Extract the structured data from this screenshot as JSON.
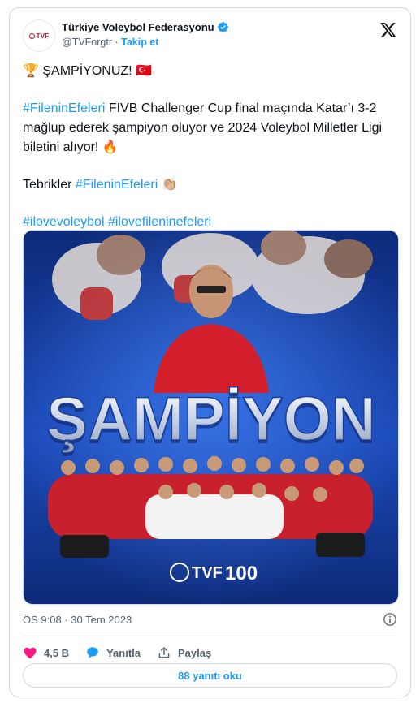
{
  "author": {
    "avatar_text": "TVF",
    "display_name": "Türkiye Voleybol Federasyonu",
    "handle": "@TVForgtr",
    "separator": " · ",
    "follow_label": "Takip et"
  },
  "tweet": {
    "line1_icon": "🏆",
    "line1_text": " ŞAMPİYONUZ! ",
    "line1_flag": "🇹🇷",
    "p2_tag": "#FileninEfeleri",
    "p2_text": " FIVB Challenger Cup final maçında Katar’ı 3-2 mağlup ederek şampiyon oluyor ve 2024 Voleybol Milletler Ligi biletini alıyor! ",
    "p2_emoji": "🔥",
    "p3_text": "Tebrikler ",
    "p3_tag": "#FileninEfeleri",
    "p3_emoji": " 👏🏼",
    "p4_tag1": "#ilovevoleybol",
    "p4_tag2": "#ilovefileninefeleri"
  },
  "media": {
    "headline": "ŞAMPİYON",
    "logo_text": "TVF",
    "logo_number": "100"
  },
  "timestamp": "ÖS 9:08 · 30 Tem 2023",
  "actions": {
    "likes": "4,5 B",
    "reply": "Yanıtla",
    "share": "Paylaş"
  },
  "read_replies": "88 yanıtı oku",
  "colors": {
    "accent": "#1d9bf0",
    "like": "#f91880",
    "text": "#0f1419",
    "muted": "#536471"
  }
}
